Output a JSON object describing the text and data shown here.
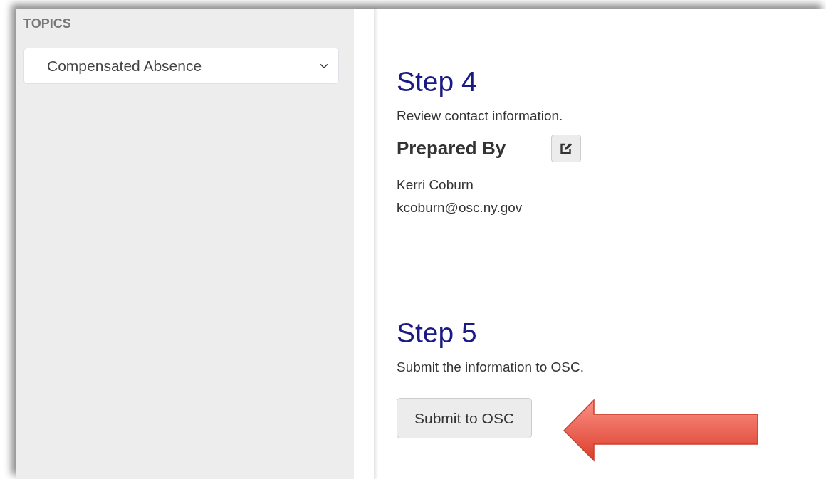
{
  "sidebar": {
    "heading": "TOPICS",
    "topic_select": {
      "value": "Compensated Absence"
    }
  },
  "steps": [
    {
      "kind": "contact",
      "title": "Step 4",
      "description": "Review contact information.",
      "section_title": "Prepared By",
      "lines": [
        "Kerri Coburn",
        "kcoburn@osc.ny.gov"
      ]
    },
    {
      "kind": "submit",
      "title": "Step 5",
      "description": "Submit the information to OSC.",
      "button": "Submit to OSC"
    }
  ]
}
